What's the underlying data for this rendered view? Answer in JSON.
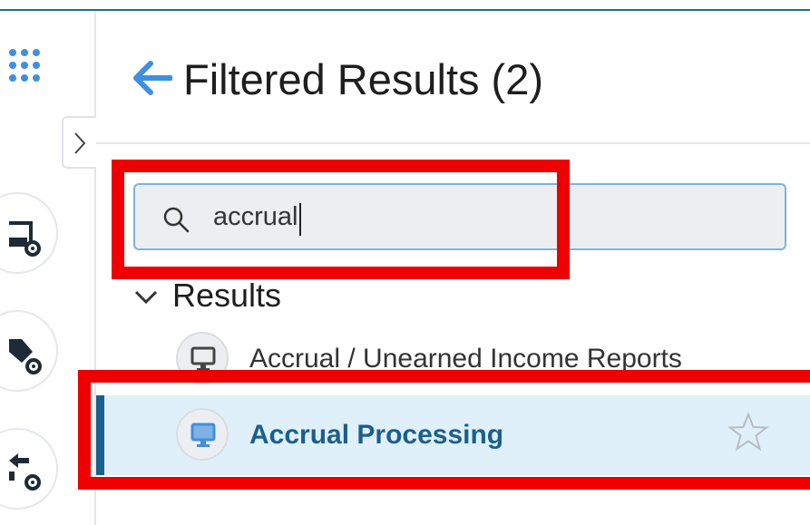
{
  "header": {
    "title": "Filtered Results (2)"
  },
  "search": {
    "value": "accrual",
    "placeholder": ""
  },
  "results": {
    "heading": "Results",
    "items": [
      {
        "label": "Accrual / Unearned Income Reports",
        "selected": false
      },
      {
        "label": "Accrual Processing",
        "selected": true
      }
    ]
  },
  "icons": {
    "apps": "apps-grid-icon",
    "back": "arrow-left-icon",
    "collapse": "chevron-right-icon",
    "search": "search-icon",
    "toggle": "chevron-down-icon",
    "item": "monitor-icon",
    "favorite": "star-outline-icon"
  },
  "colors": {
    "accent": "#3f8fe0",
    "selected_background": "#dff0fa",
    "selected_text": "#1b5f8c",
    "annotation": "#ee0000"
  }
}
